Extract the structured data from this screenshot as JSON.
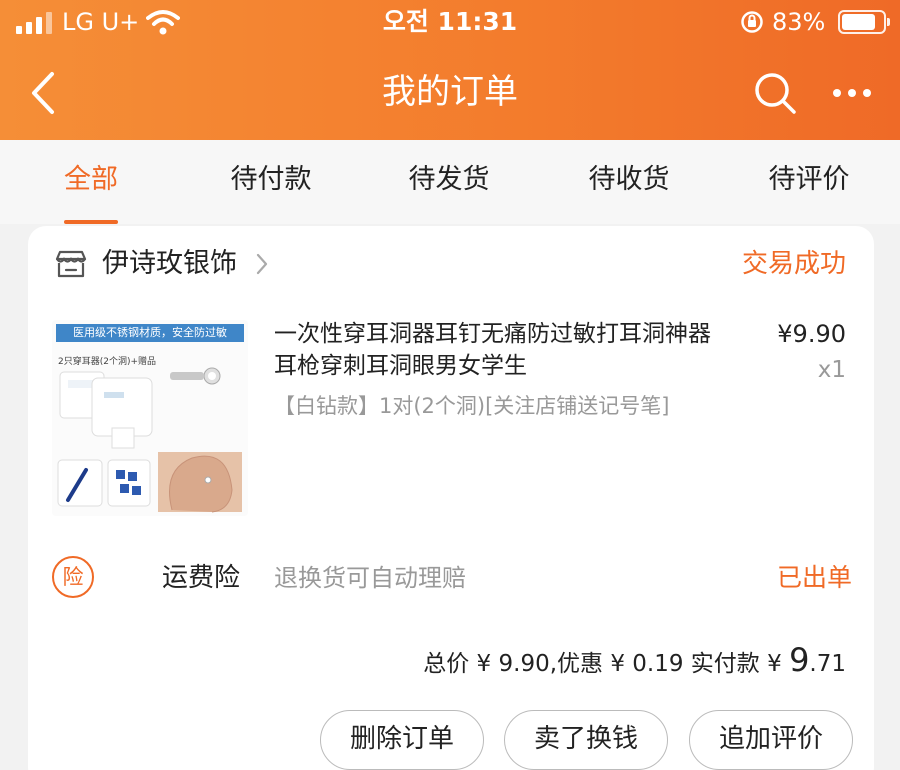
{
  "status_bar": {
    "carrier": "LG U+",
    "time": "오전 11:31",
    "battery_percent": "83%",
    "battery_level": 0.83,
    "icons": [
      "signal-icon",
      "wifi-icon",
      "rotation-lock-icon",
      "battery-icon"
    ]
  },
  "header": {
    "title": "我的订单",
    "icons": [
      "back-icon",
      "search-icon",
      "more-icon"
    ],
    "gradient_colors": [
      "#f58e37",
      "#ef6a27"
    ]
  },
  "tabs": [
    {
      "label": "全部",
      "active": true
    },
    {
      "label": "待付款"
    },
    {
      "label": "待发货"
    },
    {
      "label": "待收货"
    },
    {
      "label": "待评价"
    }
  ],
  "order": {
    "store_name": "伊诗玫银饰",
    "status": "交易成功",
    "product": {
      "title": "一次性穿耳洞器耳钉无痛防过敏打耳洞神器耳枪穿刺耳洞眼男女学生",
      "sku": "【白钻款】1对(2个洞)[关注店铺送记号笔]",
      "price": "¥9.90",
      "quantity": "x1",
      "image_banner": "医用级不锈钢材质，安全防过敏",
      "image_caption": "2只穿耳器(2个洞)+赠品"
    },
    "insurance": {
      "badge": "险",
      "name": "运费险",
      "desc": "退换货可自动理赔",
      "status": "已出单"
    },
    "summary": {
      "prefix": "总价 ¥ 9.90,优惠 ¥ 0.19 实付款 ¥ ",
      "paid_int": "9",
      "paid_dec": ".71"
    },
    "actions": {
      "delete": "删除订单",
      "resell": "卖了换钱",
      "review": "追加评价"
    }
  },
  "colors": {
    "accent": "#f06a26",
    "muted": "#999999"
  }
}
